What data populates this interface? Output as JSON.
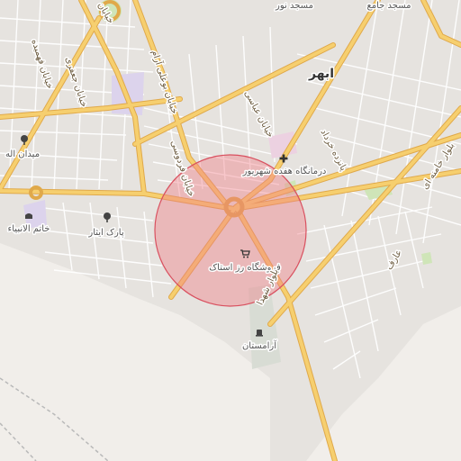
{
  "map": {
    "city": "ابهر",
    "colors": {
      "background": "#f1eeea",
      "urban": "#e3e1de",
      "block": "#ffffff",
      "major_road": "#f6cf6f",
      "major_road_casing": "#e0a94a",
      "minor_road": "#ffffff",
      "green": "#cfe5b8",
      "purple": "#dcd3ec",
      "highlight_fill": "#f07d86",
      "highlight_stroke": "#d9505f"
    },
    "labels": {
      "masjed_nour": "مسجد نور",
      "masjed_jame": "مسجد جامع",
      "clinic": "درمانگاه هفده شهریور",
      "midan_elahe": "میدان اله",
      "khatam": "خاتم الانبیاء",
      "park": "پارک ایثار",
      "shop": "فروشگاه رز استاک",
      "cemetery": "آرامستان",
      "street_abbasi": "خیابان عباسی",
      "street_pasdaran": "پانزده خرداد",
      "street_ferdowsi": "خیابان فردوسی",
      "street_boualiaram": "خیابان بوعلی آرام",
      "street_jafari": "خیابان جعفری",
      "street_fahmideh": "خیابان فهمیده",
      "street_khamenei": "بلوار خامنه ای",
      "street_aref": "عارف",
      "blvd_shahid": "بلوار شهدا",
      "top_street": "خیابان"
    },
    "icons": {
      "clinic": "cross-icon",
      "park": "tree-icon",
      "midan": "tree-icon",
      "shop": "cart-icon",
      "cemetery": "grave-icon",
      "mosque": "mosque-icon"
    }
  }
}
